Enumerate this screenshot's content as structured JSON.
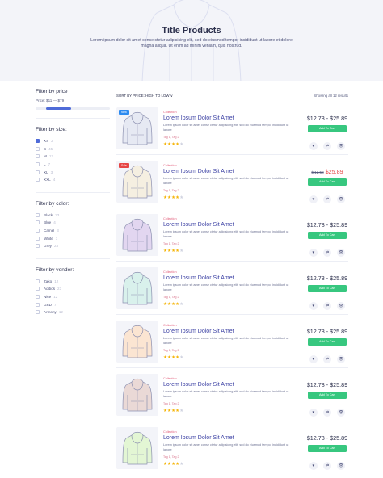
{
  "hero": {
    "title": "Title Products",
    "subtitle": "Lorem ipsum dolor sit amet conse ctetur adipisicing elit, sed do eiusmod tempor incididunt ut labore et dolore magna aliqua. Ut enim ad minim veniam, quis nostrud."
  },
  "filters": {
    "price": {
      "heading": "Filter by price",
      "range": "Price: $11 — $79"
    },
    "size": {
      "heading": "Filter by size:",
      "items": [
        {
          "label": "XS",
          "count": "2",
          "checked": true
        },
        {
          "label": "S",
          "count": "45",
          "checked": false
        },
        {
          "label": "M",
          "count": "12",
          "checked": false
        },
        {
          "label": "L",
          "count": "7",
          "checked": false
        },
        {
          "label": "XL",
          "count": "3",
          "checked": false
        },
        {
          "label": "XXL",
          "count": "4",
          "checked": false
        }
      ]
    },
    "color": {
      "heading": "Filter by color:",
      "items": [
        {
          "label": "Black",
          "count": "23"
        },
        {
          "label": "Blue",
          "count": "4"
        },
        {
          "label": "Camel",
          "count": "3"
        },
        {
          "label": "White",
          "count": "1"
        },
        {
          "label": "Grey",
          "count": "23"
        }
      ]
    },
    "vendor": {
      "heading": "Filter by vender:",
      "items": [
        {
          "label": "Zako",
          "count": "12"
        },
        {
          "label": "Adibos",
          "count": "23"
        },
        {
          "label": "Nice",
          "count": "12"
        },
        {
          "label": "G&D",
          "count": "7"
        },
        {
          "label": "Armony",
          "count": "12"
        }
      ]
    }
  },
  "toolbar": {
    "sort": "SORT BY PRICE: HIGH TO LOW ∨",
    "results": "Showing all 12 results"
  },
  "products": [
    {
      "badge": "New",
      "category": "Collection",
      "name": "Lorem Ipsum Dolor Sit Amet",
      "desc": "Lorem ipsum dolor sit amet conse ctetur adipisicing elit, sed do eiusmod tempor incididunt ut labore",
      "tags": "Tag 1, Tag 2",
      "rating": 4,
      "price": "$12.78 - $25.89",
      "old_price": "",
      "cart": "Add To Cart",
      "color": "#e6e9f3"
    },
    {
      "badge": "Sale",
      "category": "Collection",
      "name": "Lorem Ipsum Dolor Sit Amet",
      "desc": "Lorem ipsum dolor sit amet conse ctetur adipisicing elit, sed do eiusmod tempor incididunt ut labore",
      "tags": "Tag 1, Tag 2",
      "rating": 4,
      "price": "$25.89",
      "old_price": "$ 12.58",
      "cart": "Add To Cart",
      "color": "#f5efe1"
    },
    {
      "badge": "",
      "category": "Collection",
      "name": "Lorem Ipsum Dolor Sit Amet",
      "desc": "Lorem ipsum dolor sit amet conse ctetur adipisicing elit, sed do eiusmod tempor incididunt ut labore",
      "tags": "Tag 1, Tag 2",
      "rating": 4,
      "price": "$12.78 - $25.89",
      "old_price": "",
      "cart": "Add To Cart",
      "color": "#e2d6f0"
    },
    {
      "badge": "",
      "category": "Collection",
      "name": "Lorem Ipsum Dolor Sit Amet",
      "desc": "Lorem ipsum dolor sit amet conse ctetur adipisicing elit, sed do eiusmod tempor incididunt ut labore",
      "tags": "Tag 1, Tag 2",
      "rating": 4,
      "price": "$12.78 - $25.89",
      "old_price": "",
      "cart": "Add To Cart",
      "color": "#d9f1ec"
    },
    {
      "badge": "",
      "category": "Collection",
      "name": "Lorem Ipsum Dolor Sit Amet",
      "desc": "Lorem ipsum dolor sit amet conse ctetur adipisicing elit, sed do eiusmod tempor incididunt ut labore",
      "tags": "Tag 1, Tag 2",
      "rating": 4,
      "price": "$12.78 - $25.89",
      "old_price": "",
      "cart": "Add To Cart",
      "color": "#fbe5d2"
    },
    {
      "badge": "",
      "category": "Collection",
      "name": "Lorem Ipsum Dolor Sit Amet",
      "desc": "Lorem ipsum dolor sit amet conse ctetur adipisicing elit, sed do eiusmod tempor incididunt ut labore",
      "tags": "Tag 1, Tag 2",
      "rating": 4,
      "price": "$12.78 - $25.89",
      "old_price": "",
      "cart": "Add To Cart",
      "color": "#ead9d6"
    },
    {
      "badge": "",
      "category": "Collection",
      "name": "Lorem Ipsum Dolor Sit Amet",
      "desc": "Lorem ipsum dolor sit amet conse ctetur adipisicing elit, sed do eiusmod tempor incididunt ut labore",
      "tags": "Tag 1, Tag 2",
      "rating": 4,
      "price": "$12.78 - $25.89",
      "old_price": "",
      "cart": "Add To Cart",
      "color": "#e3f6d4"
    }
  ]
}
